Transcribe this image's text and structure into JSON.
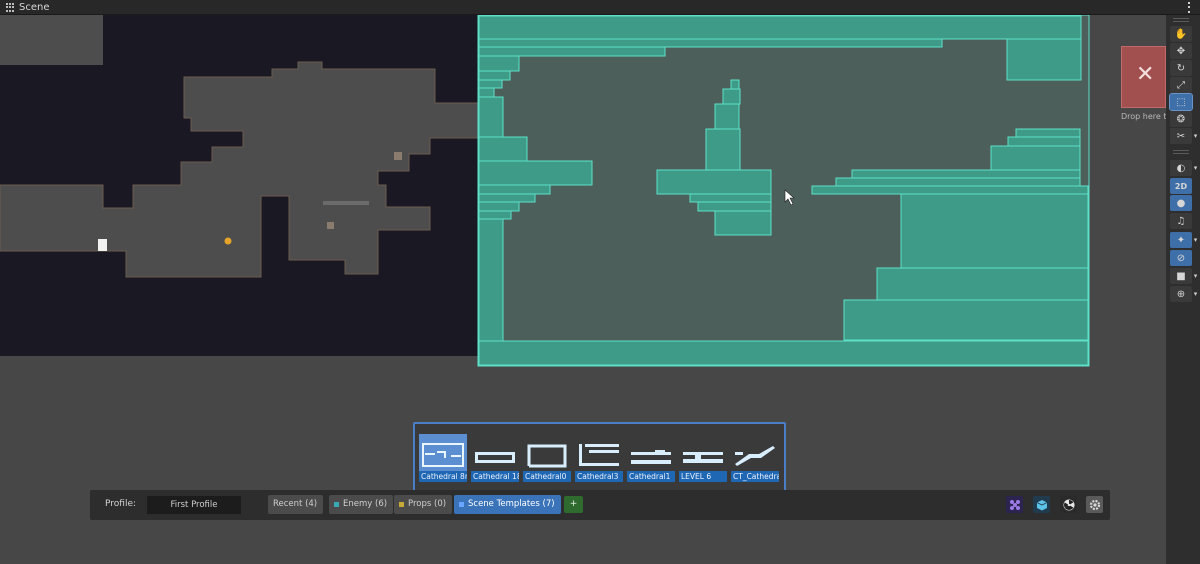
{
  "window": {
    "tab_title": "Scene",
    "tab_icon": "grid-icon",
    "menu_icon": "kebab-menu-icon"
  },
  "dropzone": {
    "close_glyph": "✕",
    "label": "Drop here to c"
  },
  "toolbar": {
    "tools": [
      {
        "name": "hand-tool",
        "icon": "hand-icon",
        "glyph": "✋"
      },
      {
        "name": "move-tool",
        "icon": "move-arrows-icon",
        "glyph": "✥"
      },
      {
        "name": "rotate-tool",
        "icon": "rotate-icon",
        "glyph": "↻"
      },
      {
        "name": "scale-tool",
        "icon": "scale-icon",
        "glyph": "⤢"
      },
      {
        "name": "rect-tool",
        "icon": "rect-transform-icon",
        "glyph": "⬚"
      },
      {
        "name": "transform-tool",
        "icon": "transform-icon",
        "glyph": "❂"
      },
      {
        "name": "custom-tool",
        "icon": "custom-tools-icon",
        "glyph": "✂"
      }
    ],
    "view": [
      {
        "name": "draw-mode",
        "icon": "shading-icon",
        "glyph": "◐"
      },
      {
        "name": "2d-toggle",
        "label": "2D"
      },
      {
        "name": "lighting-toggle",
        "icon": "light-bulb-icon",
        "glyph": "●"
      },
      {
        "name": "audio-toggle",
        "icon": "speaker-icon",
        "glyph": "♫"
      },
      {
        "name": "effects-toggle",
        "icon": "effects-icon",
        "glyph": "✦"
      },
      {
        "name": "visibility-toggle",
        "icon": "hidden-eye-icon",
        "glyph": "⊘"
      },
      {
        "name": "camera-settings",
        "icon": "camera-icon",
        "glyph": "■"
      },
      {
        "name": "gizmos-toggle",
        "icon": "gizmo-globe-icon",
        "glyph": "⊕"
      }
    ],
    "dropdown_glyph": "▾"
  },
  "palette": {
    "items": [
      {
        "label": "Cathedral 8r"
      },
      {
        "label": "Cathedral 18"
      },
      {
        "label": "Cathedral0"
      },
      {
        "label": "Cathedral3"
      },
      {
        "label": "Cathedral1"
      },
      {
        "label": "LEVEL 6"
      },
      {
        "label": "CT_Cathedra"
      }
    ]
  },
  "bottombar": {
    "profile_label": "Profile:",
    "profile_value": "First Profile",
    "tabs": [
      {
        "label": "Recent (4)",
        "color": ""
      },
      {
        "label": "Enemy (6)",
        "color": "#3aa9b5"
      },
      {
        "label": "Props (0)",
        "color": "#c7a935"
      },
      {
        "label": "Scene Templates (7)",
        "color": "#6aa6ff"
      }
    ],
    "add_label": "+",
    "icons": [
      "prefab-variant-icon",
      "cube-icon",
      "radiation-icon",
      "settings-gear-icon"
    ]
  },
  "colors": {
    "selection_fill": "#3e9b88",
    "selection_stroke": "#5fe0c8",
    "level_floor": "#4d4d4d",
    "void": "#1a1822",
    "accent": "#3b73b9"
  }
}
